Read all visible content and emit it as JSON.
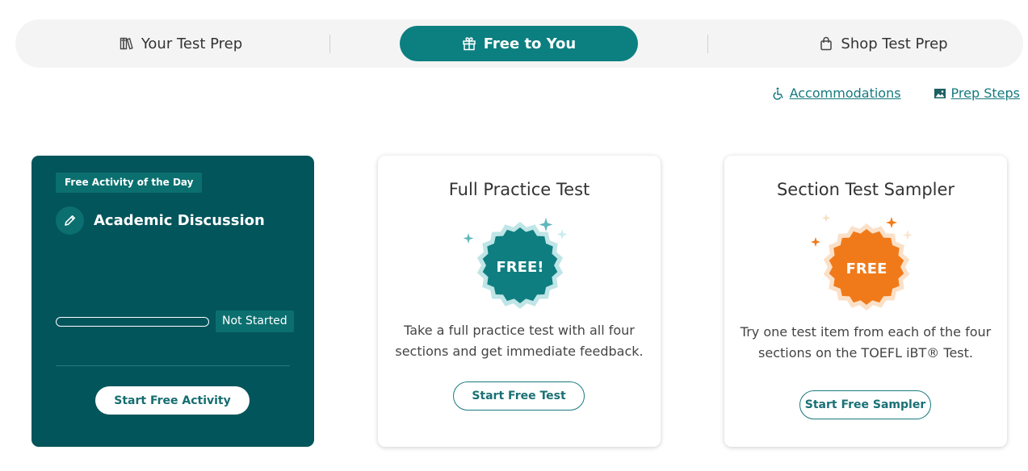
{
  "tabs": [
    {
      "label": "Your Test Prep",
      "icon": "books-icon",
      "active": false
    },
    {
      "label": "Free to You",
      "icon": "gift-icon",
      "active": true
    },
    {
      "label": "Shop Test Prep",
      "icon": "shopping-bag-icon",
      "active": false
    }
  ],
  "links": [
    {
      "label": "Accommodations",
      "icon": "accessibility-icon"
    },
    {
      "label": "Prep Steps",
      "icon": "image-icon"
    }
  ],
  "daily_card": {
    "badge": "Free Activity of the Day",
    "title": "Academic Discussion",
    "icon": "pencil-icon",
    "progress": 0,
    "status": "Not Started",
    "button": "Start Free Activity"
  },
  "practice_card": {
    "title": "Full Practice Test",
    "badge_text": "FREE!",
    "description": "Take a full practice test with all four sections and get immediate feedback.",
    "button": "Start Free Test"
  },
  "section_card": {
    "title": "Section Test Sampler",
    "badge_text": "FREE",
    "description": "Try one test item from each of the four sections on the TOEFL iBT® Test.",
    "button": "Start Free Sampler"
  },
  "colors": {
    "brand_teal": "#0c7f80",
    "dark_teal": "#02555b",
    "orange": "#f07a1a"
  }
}
